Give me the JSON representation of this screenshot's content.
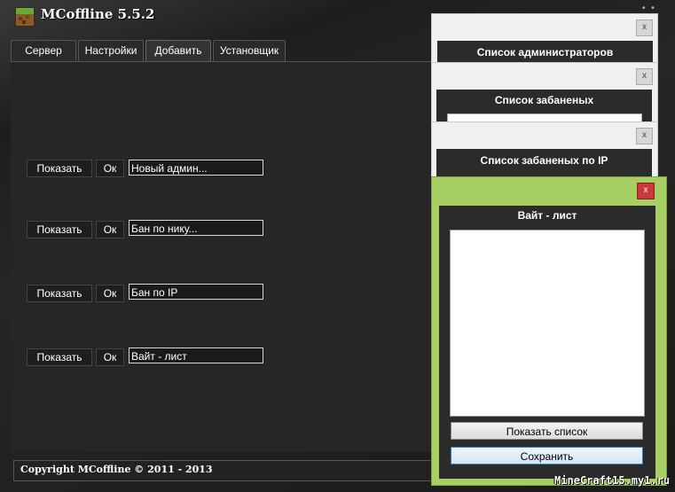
{
  "app": {
    "title": "MCoffline 5.5.2"
  },
  "tabs": [
    {
      "label": "Сервер"
    },
    {
      "label": "Настройки"
    },
    {
      "label": "Добавить"
    },
    {
      "label": "Установщик"
    }
  ],
  "rows": [
    {
      "show_label": "Показать",
      "ok_label": "Ок",
      "value": "Новый админ..."
    },
    {
      "show_label": "Показать",
      "ok_label": "Ок",
      "value": "Бан по нику..."
    },
    {
      "show_label": "Показать",
      "ok_label": "Ок",
      "value": "Бан по IP"
    },
    {
      "show_label": "Показать",
      "ok_label": "Ок",
      "value": "Вайт - лист"
    }
  ],
  "status": {
    "copyright": "Copyright MCoffline © 2011 - 2013"
  },
  "watermark": "MineCraft15.my1.ru",
  "sub_windows": {
    "admins": {
      "title": "Список администраторов",
      "close": "x"
    },
    "banned": {
      "title": "Список забаненых",
      "close": "x"
    },
    "banned_ip": {
      "title": "Список забаненых по IP",
      "close": "x"
    },
    "whitelist": {
      "title": "Вайт - лист",
      "close": "x",
      "show_button": "Показать список",
      "save_button": "Сохранить"
    }
  },
  "colors": {
    "whitelist_frame": "#a8cf63",
    "close_red": "#c9383a"
  }
}
